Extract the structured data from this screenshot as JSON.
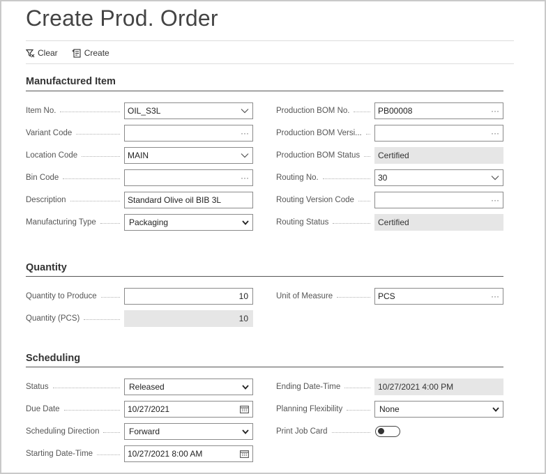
{
  "page": {
    "title": "Create Prod. Order"
  },
  "toolbar": {
    "clear_label": "Clear",
    "create_label": "Create"
  },
  "sections": {
    "manufactured": {
      "title": "Manufactured Item"
    },
    "quantity": {
      "title": "Quantity"
    },
    "scheduling": {
      "title": "Scheduling"
    }
  },
  "fields": {
    "item_no": {
      "label": "Item No.",
      "value": "OIL_S3L"
    },
    "variant_code": {
      "label": "Variant Code",
      "value": ""
    },
    "location_code": {
      "label": "Location Code",
      "value": "MAIN"
    },
    "bin_code": {
      "label": "Bin Code",
      "value": ""
    },
    "description": {
      "label": "Description",
      "value": "Standard Olive oil BIB 3L"
    },
    "manufacturing_type": {
      "label": "Manufacturing Type",
      "value": "Packaging"
    },
    "production_bom_no": {
      "label": "Production BOM No.",
      "value": "PB00008"
    },
    "production_bom_version": {
      "label": "Production BOM Versi...",
      "value": ""
    },
    "production_bom_status": {
      "label": "Production BOM Status",
      "value": "Certified"
    },
    "routing_no": {
      "label": "Routing No.",
      "value": "30"
    },
    "routing_version_code": {
      "label": "Routing Version Code",
      "value": ""
    },
    "routing_status": {
      "label": "Routing Status",
      "value": "Certified"
    },
    "quantity_to_produce": {
      "label": "Quantity to Produce",
      "value": "10"
    },
    "quantity_pcs": {
      "label": "Quantity (PCS)",
      "value": "10"
    },
    "unit_of_measure": {
      "label": "Unit of Measure",
      "value": "PCS"
    },
    "status": {
      "label": "Status",
      "value": "Released"
    },
    "due_date": {
      "label": "Due Date",
      "value": "10/27/2021"
    },
    "scheduling_direction": {
      "label": "Scheduling Direction",
      "value": "Forward"
    },
    "starting_date_time": {
      "label": "Starting Date-Time",
      "value": "10/27/2021 8:00 AM"
    },
    "ending_date_time": {
      "label": "Ending Date-Time",
      "value": "10/27/2021 4:00 PM"
    },
    "planning_flexibility": {
      "label": "Planning Flexibility",
      "value": "None"
    },
    "print_job_card": {
      "label": "Print Job Card",
      "value": false
    }
  },
  "icons": {
    "clear": "clear-filter-icon",
    "create": "create-document-icon",
    "lookup": "ellipsis-icon",
    "dropdown": "chevron-down-icon",
    "select": "caret-down-icon",
    "calendar": "calendar-icon"
  }
}
